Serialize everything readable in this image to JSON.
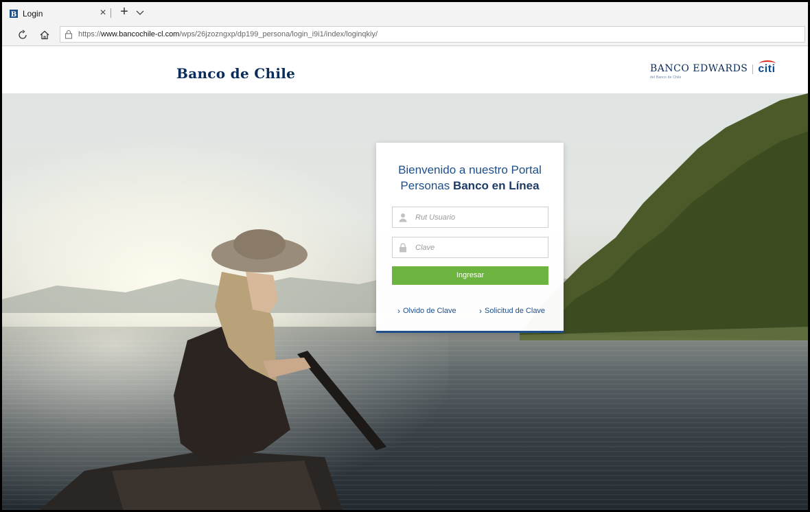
{
  "browser": {
    "tab_title": "Login",
    "tab_close": "×",
    "new_tab": "+",
    "url_scheme": "https://",
    "url_host": "www.bancochile-cl.com",
    "url_path": "/wps/26jzozngxp/dp199_persona/login_i9i1/index/loginqkiy/"
  },
  "header": {
    "logo_left": "Banco de Chile",
    "logo_right": "BANCO EDWARDS",
    "logo_right_sub": "del Banco de Chile",
    "logo_citi": "citi"
  },
  "login": {
    "welcome_line1": "Bienvenido a nuestro Portal",
    "welcome_line2_prefix": "Personas ",
    "welcome_line2_bold": "Banco en Línea",
    "rut_placeholder": "Rut Usuario",
    "clave_placeholder": "Clave",
    "submit_label": "Ingresar",
    "link_forgot": "Olvido de Clave",
    "link_request": "Solicitud de Clave",
    "chevron": "›"
  },
  "colors": {
    "brand_blue": "#1f4f8a",
    "navy": "#0b2b5a",
    "button_green": "#6db33f",
    "citi_red": "#e0261b"
  }
}
